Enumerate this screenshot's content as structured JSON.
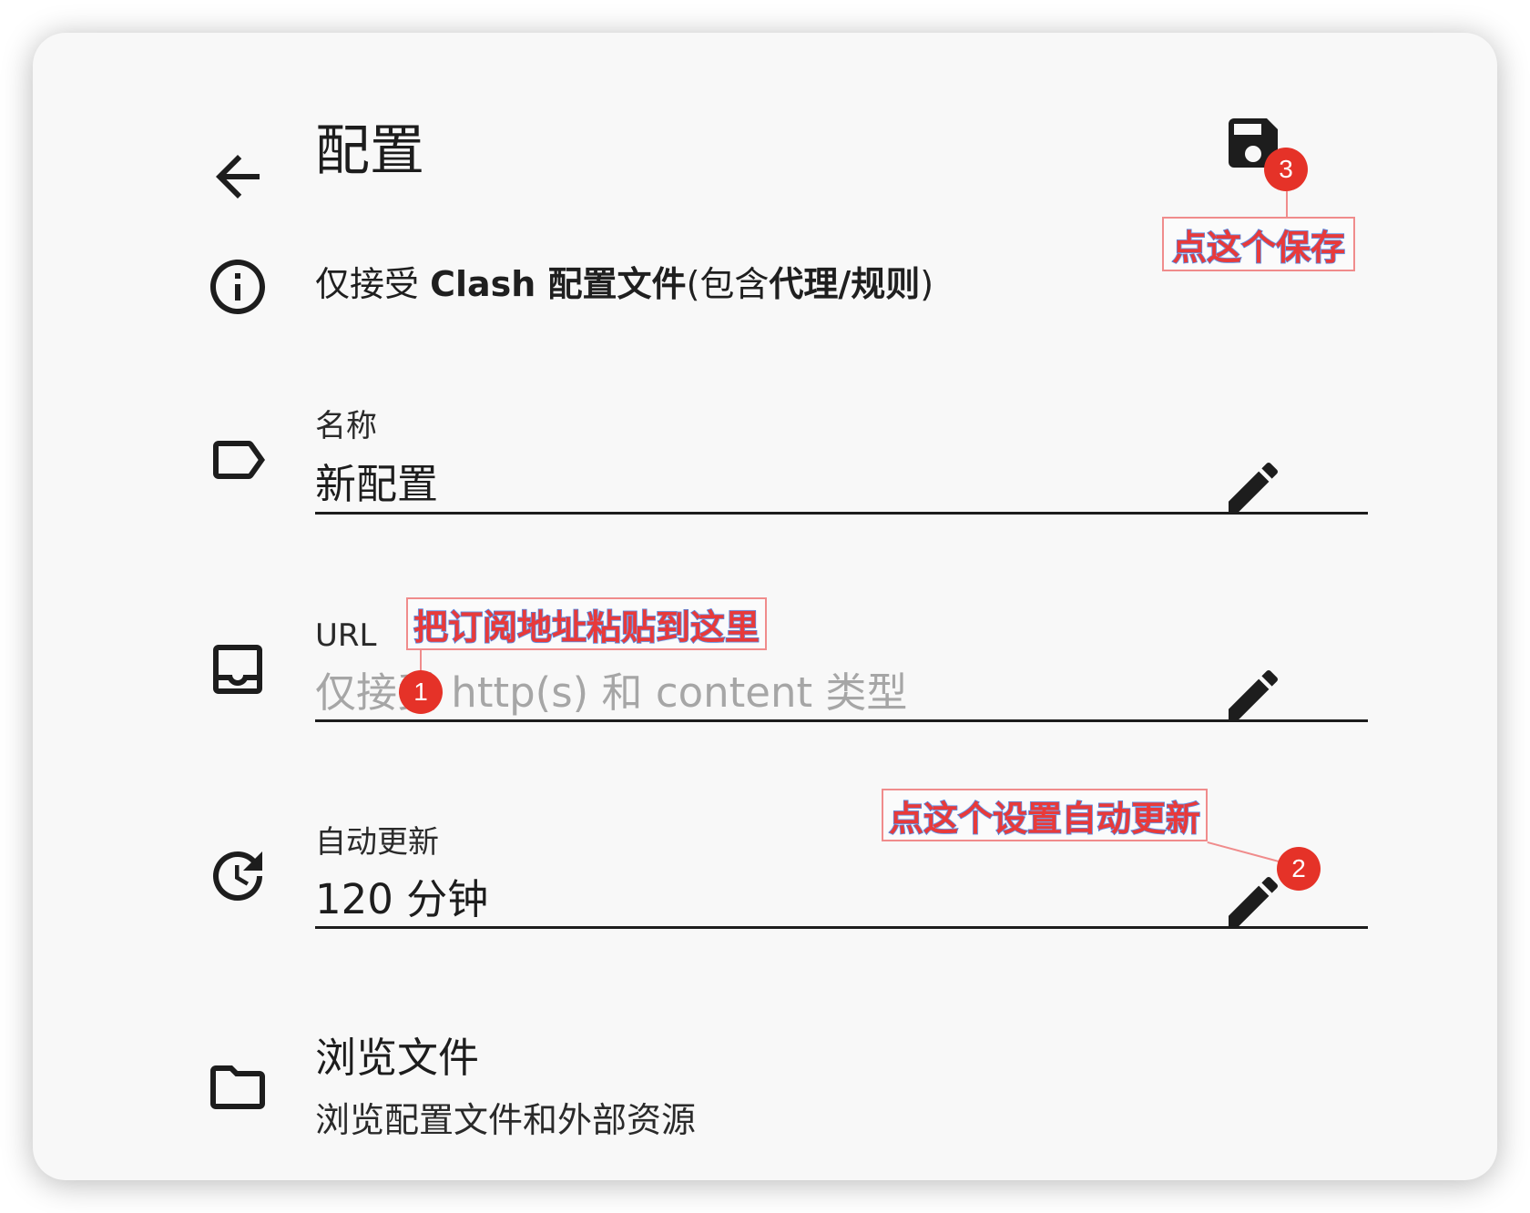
{
  "header": {
    "title": "配置"
  },
  "info": {
    "p1": "仅接受 ",
    "b1": "Clash 配置文件",
    "p2": "(包含",
    "b2": "代理/规则",
    "p3": ")"
  },
  "fields": {
    "name": {
      "label": "名称",
      "value": "新配置"
    },
    "url": {
      "label": "URL",
      "placeholder": "仅接受 http(s) 和 content 类型"
    },
    "auto_update": {
      "label": "自动更新",
      "value": "120 分钟"
    }
  },
  "browse": {
    "title": "浏览文件",
    "subtitle": "浏览配置文件和外部资源"
  },
  "annotations": {
    "save": {
      "badge": "3",
      "text": "点这个保存"
    },
    "url": {
      "badge": "1",
      "text": "把订阅地址粘贴到这里"
    },
    "update": {
      "badge": "2",
      "text": "点这个设置自动更新"
    }
  },
  "colors": {
    "card_background": "#f8f8f8",
    "badge_red": "#e53228",
    "annotation_text": "#e83a3a",
    "annotation_outline": "#2f6fd6"
  }
}
